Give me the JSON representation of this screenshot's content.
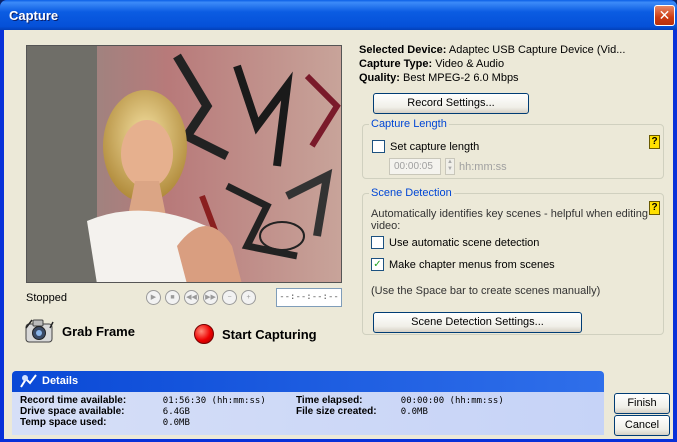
{
  "window": {
    "title": "Capture",
    "close_glyph": "✕"
  },
  "preview": {
    "status": "Stopped",
    "timecode": "--:--:--:--",
    "transport": [
      "▶",
      "■",
      "◀◀",
      "▶▶",
      "−",
      "+"
    ]
  },
  "actions": {
    "grab_frame": "Grab Frame",
    "start_capturing": "Start Capturing"
  },
  "device": {
    "selected_label": "Selected Device:",
    "selected_value": "Adaptec USB Capture Device (Vid...",
    "type_label": "Capture Type:",
    "type_value": "Video & Audio",
    "quality_label": "Quality:",
    "quality_value": "Best MPEG-2 6.0 Mbps",
    "record_settings": "Record Settings..."
  },
  "capture_length": {
    "legend": "Capture Length",
    "set_length_label": "Set capture length",
    "set_length_checked": false,
    "duration_value": "00:00:05",
    "duration_unit": "hh:mm:ss",
    "help": "?"
  },
  "scene_detection": {
    "legend": "Scene Detection",
    "description_line1": "Automatically identifies key scenes - helpful when editing",
    "description_line2": "video:",
    "auto_label": "Use automatic scene detection",
    "auto_checked": false,
    "chapter_label": "Make chapter menus from scenes",
    "chapter_checked": true,
    "manual_hint": "(Use the Space bar to create scenes manually)",
    "settings_button": "Scene Detection Settings...",
    "help": "?"
  },
  "details": {
    "title": "Details",
    "rows": [
      {
        "label": "Record time available:",
        "value": "01:56:30 (hh:mm:ss)"
      },
      {
        "label": "Drive space available:",
        "value": "6.4GB"
      },
      {
        "label": "Temp space used:",
        "value": "0.0MB"
      },
      {
        "label": "Time elapsed:",
        "value": "00:00:00 (hh:mm:ss)"
      },
      {
        "label": "File size created:",
        "value": "0.0MB"
      }
    ]
  },
  "footer": {
    "finish": "Finish",
    "cancel": "Cancel"
  },
  "colors": {
    "title_bar": "#0a5fe6",
    "group_legend": "#0046d5",
    "record_button": "#e00000",
    "dialog_bg": "#ece9d8"
  }
}
